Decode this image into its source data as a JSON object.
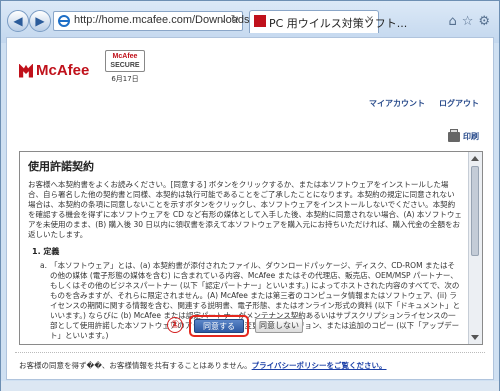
{
  "browser": {
    "back_glyph": "◀",
    "forward_glyph": "▶",
    "address_url": "http://home.mcafee.com/Downloads/F",
    "address_controls": "⌄ ↻",
    "tab_title": "PC 用ウイルス対策ソフト...",
    "tab_close": "×",
    "toolbar_icons": "⌂☆⚙"
  },
  "header": {
    "brand": "McAfee",
    "secure_badge_brand": "McAfee",
    "secure_badge_text": "SECURE",
    "secure_date": "6月17日",
    "my_account_link": "マイアカウント",
    "logout_link": "ログアウト",
    "print_link": "印刷"
  },
  "license": {
    "title": "使用許諾契約",
    "intro": "お客様へ本契約書をよくお読みください。[同意する] ボタンをクリックするか、または本ソフトウェアをインストールした場合、自ら署名した他の契約書と同様、本契約は執行可能であることをご了承したことになります。本契約の規定に同意されない場合は、本契約の条項に同意しないことを示すボタンをクリックし、本ソフトウェアをインストールしないでください。本契約を確認する機会を得ずに本ソフトウェアを CD など有形の媒体として入手した後、本契約に同意されない場合、(A) 本ソフトウェアを未使用のまま、(B) 購入後 30 日以内に領収書を添えて本ソフトウェアを購入元にお持ちいただければ、購入代金の全額をお返しいたします。",
    "section_heading": "1. 定義",
    "item_label": "a.",
    "item_text": "「本ソフトウェア」とは、(a) 本契約書が添付されたファイル、ダウンロードパッケージ、ディスク、CD-ROM またはその他の媒体 (電子形態の媒体を含む) に含まれている内容、McAfee またはその代理店、販売店、OEM/MSP パートナー、もしくはその他のビジネスパートナー (以下「認定パートナー」といいます。) によってホストされた内容のすべてで、次のものを含みますが、それらに限定されません。(A) McAfee または第三者のコンピュータ情報またはソフトウェア、(ii) ライセンスの期間に関する情報を含む、関連する説明書、電子形態、またはオンライン形式の資料 (以下「ドキュメント」といいます。) ならびに (b) McAfee または認定パートナーがメンテナンス契約あるいはサブスクリプションライセンスの一部として使用許諾した本ソフトウェアのアップグレード、変更されたバージョン、または追加のコピー (以下「アップデート」といいます。)"
  },
  "actions": {
    "step_marker": "①",
    "agree_label": "同意する",
    "disagree_label": "同意しない"
  },
  "footer": {
    "text": "お客様の同意を得ず��、お客様情報を共有することはありません。",
    "privacy_link": "プライバシーポリシーをご覧ください。"
  },
  "colors": {
    "brand_red": "#c0111b",
    "link_blue": "#2a4c8c",
    "highlight_red": "#e4281e",
    "agree_blue": "#2e5aa3"
  }
}
